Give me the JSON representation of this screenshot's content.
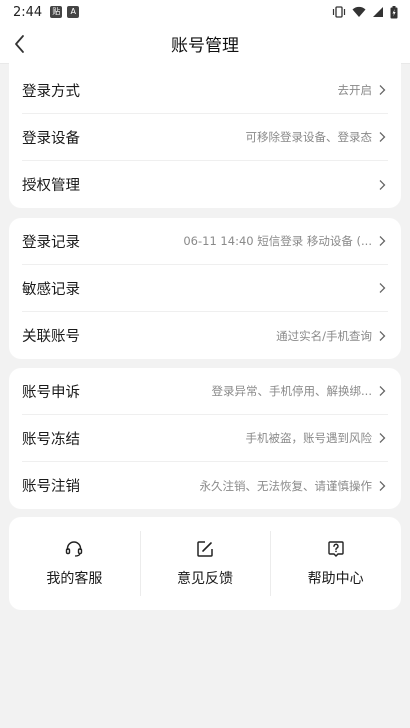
{
  "status_bar": {
    "time": "2:44",
    "badge1": "贴",
    "badge2": "A"
  },
  "header": {
    "title": "账号管理"
  },
  "section1": {
    "items": [
      {
        "label": "登录方式",
        "value": "去开启"
      },
      {
        "label": "登录设备",
        "value": "可移除登录设备、登录态"
      },
      {
        "label": "授权管理",
        "value": ""
      }
    ]
  },
  "section2": {
    "items": [
      {
        "label": "登录记录",
        "value": "06-11 14:40 短信登录 移动设备 (..."
      },
      {
        "label": "敏感记录",
        "value": ""
      },
      {
        "label": "关联账号",
        "value": "通过实名/手机查询"
      }
    ]
  },
  "section3": {
    "items": [
      {
        "label": "账号申诉",
        "value": "登录异常、手机停用、解换绑..."
      },
      {
        "label": "账号冻结",
        "value": "手机被盗，账号遇到风险"
      },
      {
        "label": "账号注销",
        "value": "永久注销、无法恢复、请谨慎操作"
      }
    ]
  },
  "tools": {
    "items": [
      {
        "label": "我的客服",
        "icon": "headset-icon"
      },
      {
        "label": "意见反馈",
        "icon": "edit-icon"
      },
      {
        "label": "帮助中心",
        "icon": "help-icon"
      }
    ]
  },
  "colors": {
    "background": "#f2f2f2",
    "card": "#ffffff",
    "secondary_text": "#8a8a8a"
  }
}
